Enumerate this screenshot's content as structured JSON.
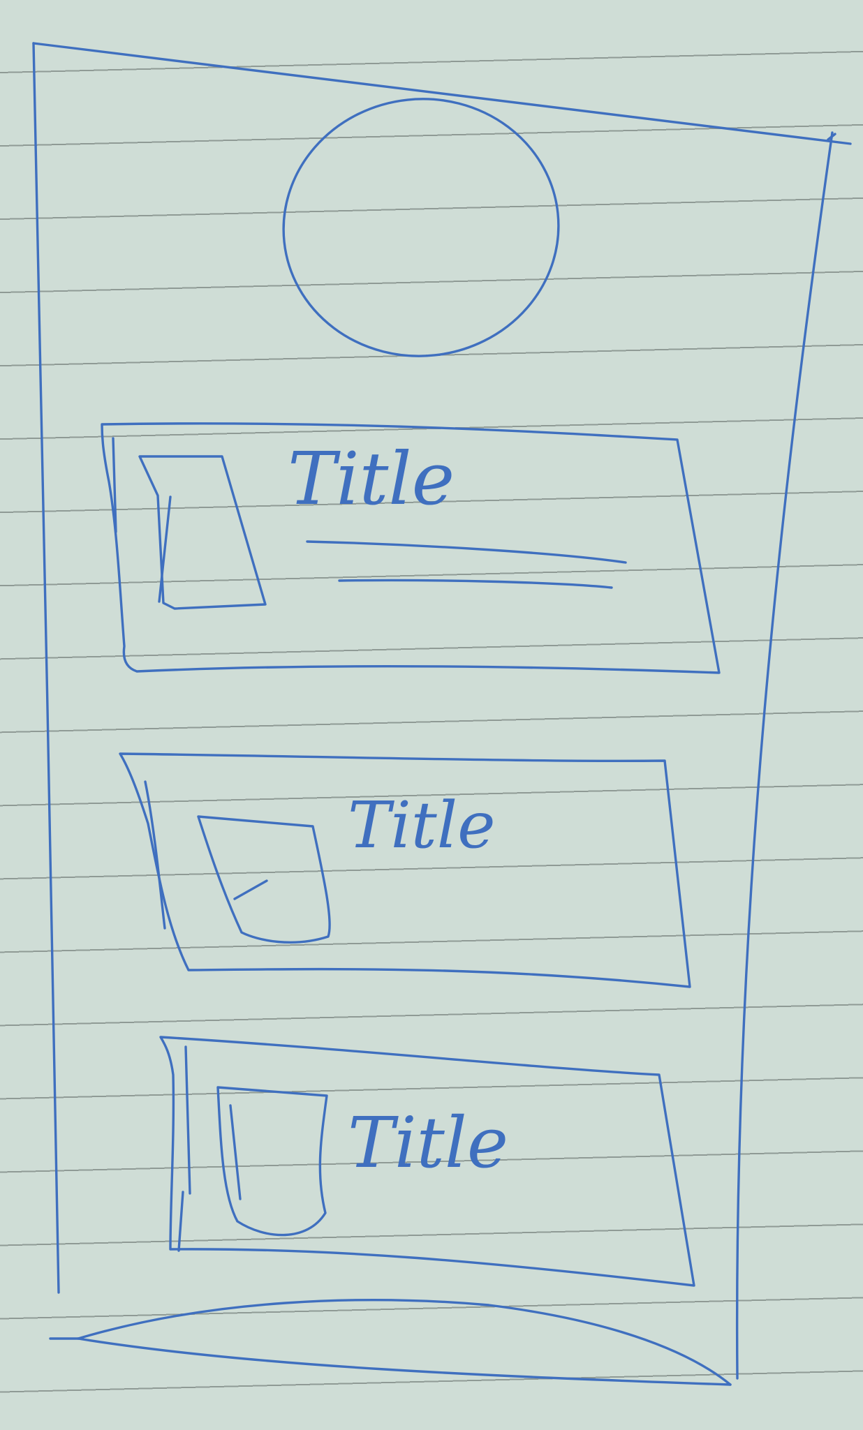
{
  "wireframe": {
    "cards": [
      {
        "title": "Title"
      },
      {
        "title": "Title"
      },
      {
        "title": "Title"
      }
    ]
  },
  "colors": {
    "ink": "#3f6fbf",
    "paper": "#cfddd6",
    "rule_lines": "#8f9a95"
  }
}
